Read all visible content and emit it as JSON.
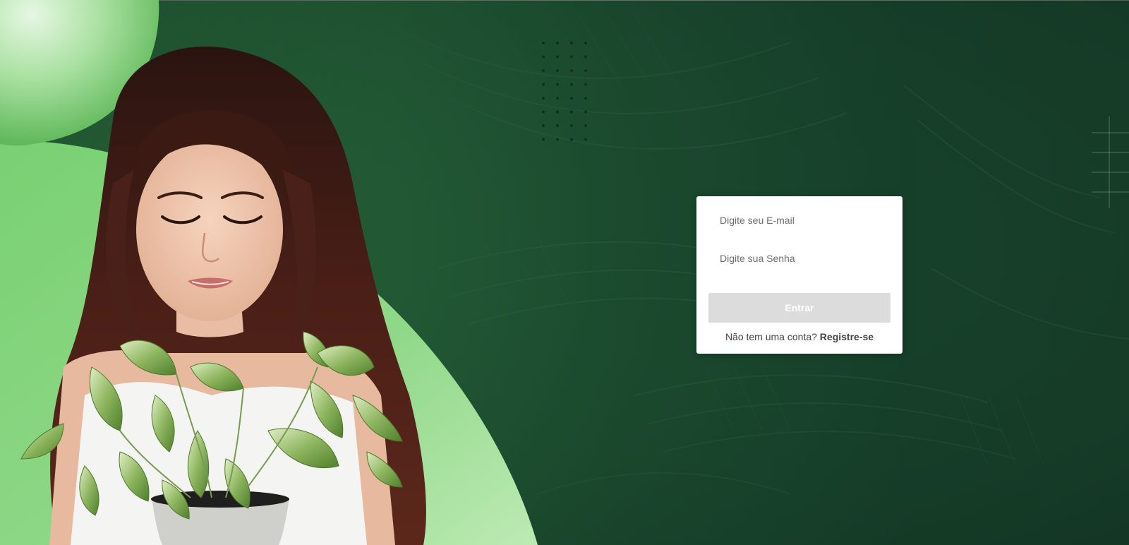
{
  "login": {
    "email_placeholder": "Digite seu E-mail",
    "password_placeholder": "Digite sua Senha",
    "submit_label": "Entrar",
    "signup_prompt": "Não tem uma conta?",
    "signup_link": "Registre-se"
  },
  "colors": {
    "background": "#173f2a",
    "accent_green": "#7fd47a",
    "card": "#ffffff",
    "button_disabled": "#dcdcdc"
  }
}
